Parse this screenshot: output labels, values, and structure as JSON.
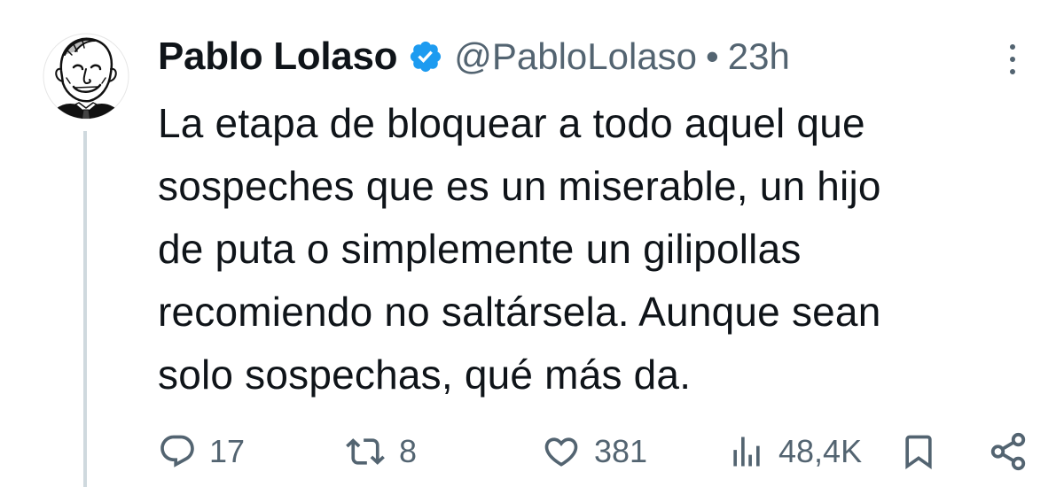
{
  "author": {
    "name": "Pablo Lolaso",
    "handle": "@PabloLolaso",
    "separator": "•",
    "time": "23h",
    "verified": true
  },
  "tweet": {
    "lines": [
      "La etapa de bloquear a todo aquel que",
      "sospeches que es un miserable, un hijo",
      "de puta o simplemente un gilipollas",
      "recomiendo no saltársela. Aunque sean",
      "solo sospechas, qué más da."
    ]
  },
  "actions": {
    "replies": "17",
    "retweets": "8",
    "likes": "381",
    "views": "48,4K"
  },
  "icons": {
    "reply": "reply-icon",
    "retweet": "retweet-icon",
    "like": "heart-icon",
    "views": "views-icon",
    "bookmark": "bookmark-icon",
    "share": "share-icon",
    "more": "more-icon",
    "verified": "verified-badge-icon"
  },
  "colors": {
    "text": "#0f1419",
    "secondary": "#536471",
    "verified": "#1d9bf0",
    "thread_line": "#cfd9de"
  }
}
